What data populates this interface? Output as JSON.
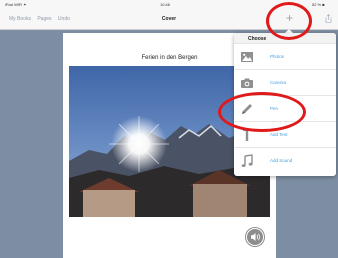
{
  "status_bar": {
    "carrier": "iPad WiFi ✦",
    "time": "10:46",
    "battery": "52 % ■"
  },
  "nav_bar": {
    "left_items": [
      "My Books",
      "Pages",
      "Undo"
    ],
    "title": "Cover",
    "add_glyph": "+"
  },
  "page": {
    "title": "Ferien in den Bergen"
  },
  "popover": {
    "header": "Choose",
    "items": [
      {
        "label": "Photos",
        "icon": "photos-icon"
      },
      {
        "label": "Camera",
        "icon": "camera-icon"
      },
      {
        "label": "Pen",
        "icon": "pen-icon"
      },
      {
        "label": "Add Text",
        "icon": "text-icon"
      },
      {
        "label": "Add Sound",
        "icon": "music-note-icon"
      }
    ]
  },
  "colors": {
    "background": "#7d8ea2",
    "accent": "#4aa0e0",
    "annotation": "#e01a1a"
  }
}
